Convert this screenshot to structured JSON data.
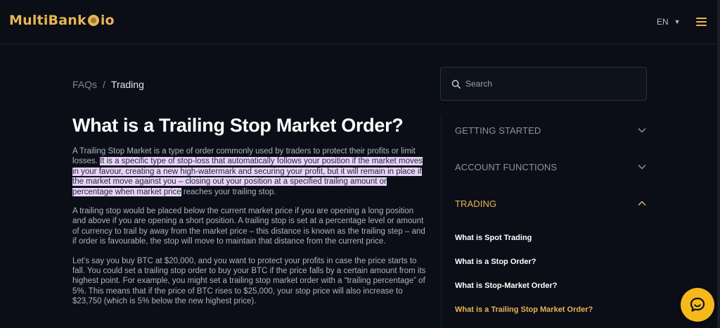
{
  "header": {
    "logo_part1": "MultiBank",
    "logo_part2": "io",
    "language": "EN"
  },
  "breadcrumb": {
    "parent": "FAQs",
    "separator": "/",
    "current": "Trading"
  },
  "article": {
    "title": "What is a Trailing Stop Market Order?",
    "p1_a": "A Trailing Stop Market is a type of order commonly used by traders to protect their profits or limit losses. ",
    "p1_highlight": " It is a specific type of stop-loss that automatically follows your position if the market moves in your favour, creating a new high-watermark and securing your profit, but it will remain in place if the market move against you – closing out your position at a specified trailing amount or percentage when market price",
    "p1_b": " reaches your trailing stop.",
    "p2": "A trailing stop would be placed below the current market price if you are opening a long position and above if you are opening a short position. A trailing stop is set at a percentage level or amount of currency to trail by away from the market price – this distance is known as the trailing step – and if order is favourable, the stop will move to maintain that distance from the current price.",
    "p3": "Let’s say you buy BTC at $20,000, and you want to protect your profits in case the price starts to fall. You could set a trailing stop order to buy your BTC if the price falls by a certain amount from its highest point. For example, you might set a trailing stop market order with a “trailing percentage” of 5%. This means that if the price of BTC rises to $25,000, your stop price will also increase to $23,750 (which is 5% below the new highest price)."
  },
  "search": {
    "placeholder": "Search"
  },
  "sidebar": {
    "categories": [
      {
        "label": "GETTING STARTED"
      },
      {
        "label": "ACCOUNT FUNCTIONS"
      },
      {
        "label": "TRADING"
      }
    ],
    "trading_items": [
      {
        "label": "What is Spot Trading"
      },
      {
        "label": "What is a Stop Order?"
      },
      {
        "label": "What is Stop-Market Order?"
      },
      {
        "label": "What is a Trailing Stop Market Order?"
      }
    ]
  },
  "colors": {
    "accent": "#e9b554",
    "background": "#0b0e17",
    "highlight": "#e6d4f5",
    "chat_button": "#f5b91a"
  },
  "icons": [
    "coin-logo-icon",
    "caret-down-icon",
    "hamburger-menu-icon",
    "search-icon",
    "chevron-down-icon",
    "chevron-up-icon",
    "chat-icon"
  ]
}
